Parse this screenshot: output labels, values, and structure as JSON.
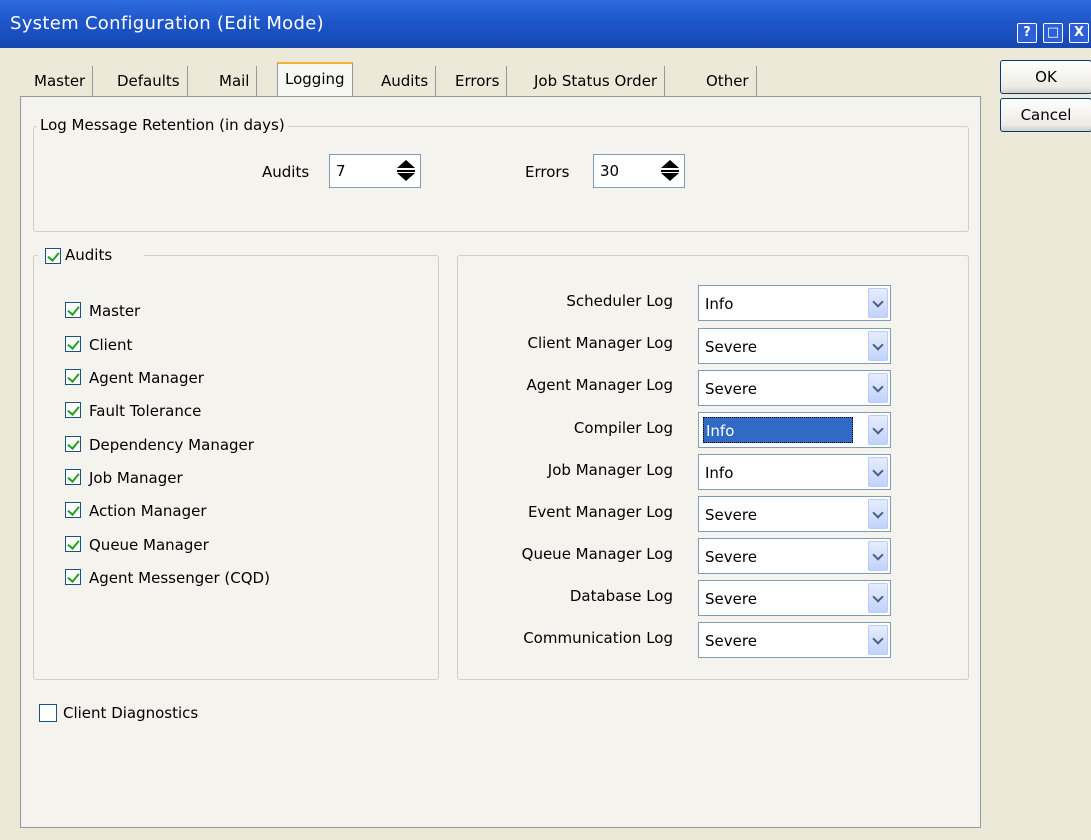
{
  "window": {
    "title": "System Configuration (Edit Mode)",
    "buttons": [
      "?",
      "□",
      "X"
    ]
  },
  "tabs": [
    "Master",
    "Defaults",
    "Mail",
    "Logging",
    "Audits",
    "Errors",
    "Job Status Order",
    "Other"
  ],
  "active_tab": "Logging",
  "retention": {
    "title": "Log Message Retention (in days)",
    "audits_label": "Audits",
    "audits_value": "7",
    "errors_label": "Errors",
    "errors_value": "30"
  },
  "audits_group": {
    "label": "Audits",
    "checked": true,
    "items": [
      {
        "label": "Master",
        "checked": true
      },
      {
        "label": "Client",
        "checked": true
      },
      {
        "label": "Agent Manager",
        "checked": true
      },
      {
        "label": "Fault Tolerance",
        "checked": true
      },
      {
        "label": "Dependency Manager",
        "checked": true
      },
      {
        "label": "Job Manager",
        "checked": true
      },
      {
        "label": "Action Manager",
        "checked": true
      },
      {
        "label": "Queue Manager",
        "checked": true
      },
      {
        "label": "Agent Messenger (CQD)",
        "checked": true
      }
    ]
  },
  "logs": [
    {
      "label": "Scheduler Log",
      "value": "Info"
    },
    {
      "label": "Client Manager Log",
      "value": "Severe"
    },
    {
      "label": "Agent Manager Log",
      "value": "Severe"
    },
    {
      "label": "Compiler Log",
      "value": "Info",
      "selected": true
    },
    {
      "label": "Job Manager Log",
      "value": "Info"
    },
    {
      "label": "Event Manager Log",
      "value": "Severe"
    },
    {
      "label": "Queue Manager Log",
      "value": "Severe"
    },
    {
      "label": "Database Log",
      "value": "Severe"
    },
    {
      "label": "Communication Log",
      "value": "Severe"
    }
  ],
  "client_diagnostics": {
    "label": "Client Diagnostics",
    "checked": false
  },
  "actions": {
    "ok": "OK",
    "cancel": "Cancel"
  }
}
